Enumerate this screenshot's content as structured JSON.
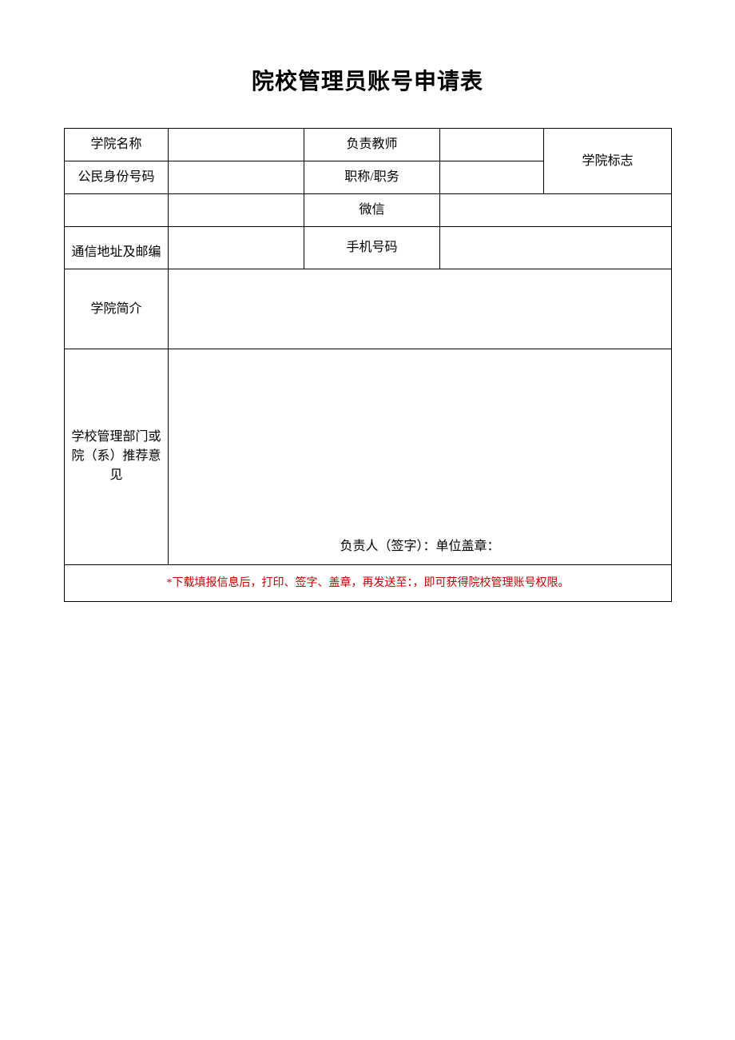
{
  "title": "院校管理员账号申请表",
  "labels": {
    "college_name": "学院名称",
    "responsible_teacher": "负责教师",
    "citizen_id": "公民身份号码",
    "title_position": "职称/职务",
    "college_logo": "学院标志",
    "wechat": "微信",
    "address_postcode": "通信地址及邮编",
    "mobile": "手机号码",
    "college_intro": "学院简介",
    "recommendation": "学校管理部门或院（系）推荐意见",
    "signature_line": "负责人（签字）：单位盖章："
  },
  "footer_note": "*下载填报信息后，打印、签字、盖章，再发送至：，即可获得院校管理账号权限。"
}
